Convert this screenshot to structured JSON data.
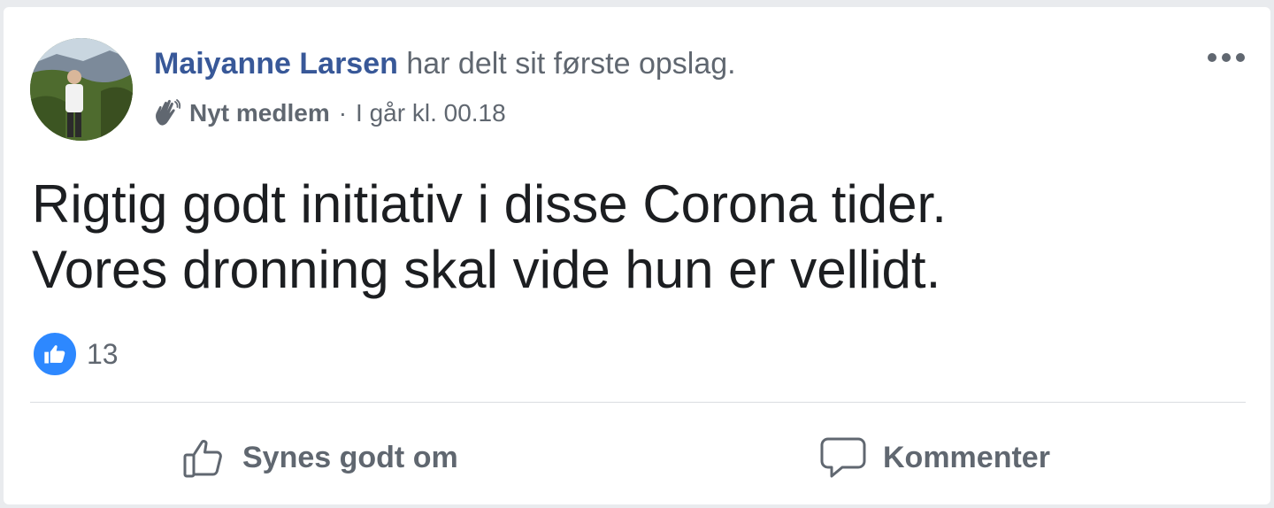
{
  "post": {
    "author_name": "Maiyanne Larsen",
    "author_action": "har delt sit første opslag.",
    "badge_label": "Nyt medlem",
    "separator": "·",
    "timestamp": "I går kl. 00.18",
    "text_line_1": "Rigtig godt initiativ i disse Corona tider.",
    "text_line_2": "Vores dronning skal vide hun er vellidt.",
    "reaction_count": "13",
    "avatar_icon": "profile-photo",
    "badge_icon": "waving-hand-icon",
    "more_icon": "more-options-icon"
  },
  "actions": {
    "like_label": "Synes godt om",
    "like_icon": "thumbs-up-icon",
    "comment_label": "Kommenter",
    "comment_icon": "comment-bubble-icon"
  },
  "colors": {
    "author_link": "#385898",
    "secondary_text": "#606770",
    "body_text": "#1c1e21",
    "like_blue": "#2d88ff",
    "card_background": "#ffffff",
    "page_background": "#e9ebee"
  }
}
